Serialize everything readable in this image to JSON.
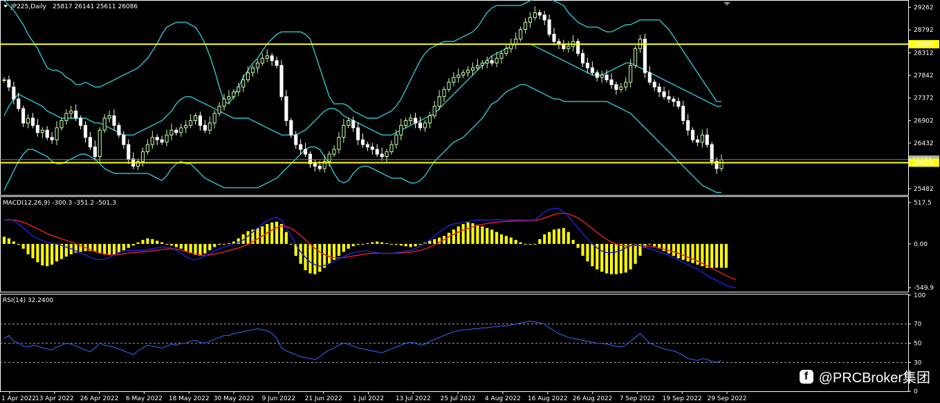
{
  "header": {
    "symbol_info": "JP225,Daily",
    "ohlc": "25817 26141 25611 26086"
  },
  "macd": {
    "label": "MACD(12,26,9) -300.3 -351.2 -501.3"
  },
  "rsi": {
    "label": "RSI(14) 32.2400"
  },
  "watermark": {
    "icon": "f",
    "text": "@PRCBroker集团"
  },
  "colors": {
    "background": "#000000",
    "bull_candle": "#ccffaa",
    "bear_candle": "#ffffff",
    "bollinger": "#2ec7d0",
    "support_resistance": "#ffff00",
    "macd_hist": "#ffff00",
    "macd_line": "#1f1fe0",
    "signal_line": "#e02020",
    "rsi_line": "#2f6fff"
  },
  "chart_data": [
    {
      "type": "candlestick",
      "name": "price",
      "x_labels": [
        "1 Apr 2022",
        "13 Apr 2022",
        "26 Apr 2022",
        "6 May 2022",
        "18 May 2022",
        "30 May 2022",
        "9 Jun 2022",
        "21 Jun 2022",
        "1 Jul 2022",
        "13 Jul 2022",
        "25 Jul 2022",
        "4 Aug 2022",
        "16 Aug 2022",
        "26 Aug 2022",
        "7 Sep 2022",
        "19 Sep 2022",
        "29 Sep 2022"
      ],
      "y_ticks": [
        29262,
        28792,
        28312,
        27842,
        27372,
        26902,
        26432,
        25482
      ],
      "ylim": [
        25350,
        29400
      ],
      "close": [
        27750,
        27600,
        27350,
        27150,
        26850,
        26950,
        26800,
        26650,
        26700,
        26550,
        26500,
        26750,
        26900,
        27050,
        27100,
        26950,
        26800,
        26550,
        26350,
        26150,
        26700,
        26950,
        27000,
        26800,
        26600,
        26400,
        26100,
        25950,
        26050,
        26250,
        26400,
        26550,
        26500,
        26450,
        26600,
        26700,
        26650,
        26750,
        26800,
        26900,
        27000,
        26800,
        26700,
        26850,
        27050,
        27200,
        27350,
        27400,
        27500,
        27600,
        27750,
        27900,
        28000,
        28100,
        28200,
        28250,
        28150,
        28050,
        27400,
        26900,
        26600,
        26400,
        26300,
        26200,
        26000,
        25950,
        25900,
        26050,
        26200,
        26300,
        26550,
        26800,
        26900,
        26750,
        26500,
        26400,
        26350,
        26300,
        26200,
        26150,
        26250,
        26400,
        26600,
        26800,
        26900,
        26950,
        26850,
        26750,
        26850,
        27000,
        27200,
        27400,
        27550,
        27700,
        27800,
        27850,
        27900,
        27950,
        28000,
        28050,
        28100,
        28150,
        28100,
        28200,
        28300,
        28400,
        28500,
        28600,
        28800,
        28950,
        29050,
        29150,
        29100,
        29000,
        28700,
        28550,
        28500,
        28400,
        28450,
        28550,
        28300,
        28100,
        28000,
        27900,
        27800,
        27850,
        27750,
        27650,
        27550,
        27600,
        27700,
        28050,
        28400,
        28600,
        27900,
        27700,
        27600,
        27500,
        27400,
        27350,
        27300,
        27200,
        26900,
        26700,
        26500,
        26450,
        26600,
        26400,
        26050,
        25900,
        26086
      ],
      "bands": [
        {
          "name": "Upper band",
          "values": [
            29400,
            29300,
            29200,
            29050,
            28900,
            28700,
            28550,
            28400,
            28200,
            28000,
            27950,
            27950,
            27900,
            27800,
            27750,
            27650,
            27650,
            27700,
            27650,
            27600,
            27600,
            27650,
            27700,
            27750,
            27800,
            27850,
            27900,
            27950,
            28000,
            28100,
            28200,
            28350,
            28500,
            28700,
            28850,
            28900,
            28950,
            28950,
            28950,
            28900,
            28850,
            28700,
            28500,
            28250,
            27950,
            27600,
            27300,
            27250,
            27400,
            27600,
            27800,
            27950,
            28100,
            28200,
            28350,
            28500,
            28600,
            28700,
            28750,
            28750,
            28750,
            28750,
            28750,
            28700,
            28600,
            28300,
            28000,
            27700,
            27400,
            27250,
            27250,
            27250,
            27200,
            27100,
            27050,
            27000,
            26950,
            26950,
            26950,
            27000,
            27050,
            27100,
            27200,
            27350,
            27550,
            27750,
            27950,
            28150,
            28300,
            28400,
            28450,
            28500,
            28550,
            28550,
            28550,
            28600,
            28650,
            28700,
            28750,
            28850,
            29000,
            29150,
            29250,
            29300,
            29300,
            29300,
            29300,
            29300,
            29300,
            29350,
            29400,
            29450,
            29450,
            29450,
            29450,
            29400,
            29350,
            29300,
            29150,
            29050,
            28950,
            28900,
            28850,
            28850,
            28850,
            28800,
            28750,
            28750,
            28800,
            28850,
            28900,
            28900,
            28950,
            29000,
            29000,
            29000,
            29000,
            29000,
            28900,
            28800,
            28650,
            28500,
            28350,
            28200,
            28050,
            27900,
            27750,
            27600,
            27450,
            27300,
            27300
          ]
        },
        {
          "name": "Middle band",
          "values": [
            27000,
            27200,
            27350,
            27450,
            27400,
            27350,
            27300,
            27250,
            27200,
            27100,
            27050,
            27000,
            26950,
            26950,
            26950,
            26950,
            26950,
            26950,
            26900,
            26850,
            26850,
            26800,
            26750,
            26700,
            26650,
            26600,
            26600,
            26600,
            26650,
            26700,
            26750,
            26800,
            26850,
            26900,
            27000,
            27100,
            27250,
            27350,
            27400,
            27400,
            27350,
            27300,
            27250,
            27200,
            27150,
            27100,
            27050,
            27000,
            26950,
            26950,
            26950,
            26950,
            26900,
            26850,
            26800,
            26750,
            26700,
            26650,
            26600,
            26600,
            26600,
            26600,
            26650,
            26700,
            26800,
            26900,
            27000,
            27100,
            27150,
            27150,
            27100,
            27000,
            26950,
            26900,
            26850,
            26800,
            26750,
            26700,
            26650,
            26600,
            26600,
            26600,
            26650,
            26700,
            26750,
            26800,
            26850,
            26900,
            26950,
            27000,
            27050,
            27150,
            27250,
            27350,
            27450,
            27550,
            27650,
            27750,
            27850,
            27950,
            28050,
            28150,
            28250,
            28300,
            28350,
            28400,
            28450,
            28500,
            28500,
            28500,
            28500,
            28450,
            28400,
            28350,
            28300,
            28250,
            28200,
            28150,
            28100,
            28050,
            28000,
            27950,
            27900,
            27850,
            27850,
            27850,
            27900,
            27950,
            28000,
            28050,
            28100,
            28100,
            28050,
            28000,
            27950,
            27900,
            27850,
            27800,
            27750,
            27700,
            27650,
            27600,
            27550,
            27500,
            27450,
            27400,
            27350,
            27300,
            27250,
            27200,
            27200
          ]
        },
        {
          "name": "Lower band",
          "values": [
            25450,
            25650,
            25850,
            26050,
            26200,
            26300,
            26300,
            26250,
            26200,
            26150,
            26050,
            26000,
            26000,
            26050,
            26100,
            26150,
            26200,
            26200,
            26150,
            26100,
            26000,
            25900,
            25850,
            25800,
            25800,
            25800,
            25800,
            25800,
            25800,
            25800,
            25800,
            25750,
            25700,
            25650,
            25750,
            25900,
            26000,
            26050,
            26000,
            26000,
            25900,
            25800,
            25700,
            25650,
            25600,
            25550,
            25500,
            25500,
            25500,
            25500,
            25500,
            25500,
            25500,
            25500,
            25550,
            25600,
            25650,
            25700,
            25800,
            25900,
            26000,
            26100,
            26200,
            26300,
            26350,
            26350,
            26300,
            26150,
            26000,
            25800,
            25650,
            25600,
            25650,
            25800,
            25900,
            25950,
            25950,
            25900,
            25850,
            25800,
            25750,
            25700,
            25700,
            25700,
            25650,
            25600,
            25600,
            25650,
            25750,
            25900,
            26050,
            26150,
            26250,
            26350,
            26450,
            26500,
            26550,
            26650,
            26750,
            26850,
            26950,
            27100,
            27250,
            27300,
            27400,
            27500,
            27550,
            27600,
            27650,
            27650,
            27600,
            27550,
            27500,
            27450,
            27400,
            27350,
            27350,
            27300,
            27300,
            27300,
            27300,
            27300,
            27300,
            27300,
            27300,
            27300,
            27300,
            27250,
            27200,
            27150,
            27100,
            27050,
            26950,
            26850,
            26750,
            26650,
            26550,
            26450,
            26350,
            26250,
            26150,
            26050,
            25950,
            25850,
            25750,
            25650,
            25550,
            25500,
            25450,
            25400,
            25400
          ]
        }
      ],
      "horizontal_lines": [
        {
          "value": 28493,
          "label": "28493"
        },
        {
          "value": 26022,
          "label": "26022"
        }
      ],
      "price_marker": {
        "value": 26086,
        "label": "26086"
      }
    },
    {
      "type": "bar",
      "name": "MACD",
      "y_ticks": [
        517.5,
        0.0,
        -549.9
      ],
      "y_tick_labels": [
        "517.5",
        "0.00",
        "-549.9"
      ],
      "ylim": [
        -600,
        580
      ],
      "histogram": [
        90,
        70,
        30,
        -10,
        -60,
        -130,
        -180,
        -230,
        -270,
        -280,
        -260,
        -220,
        -190,
        -160,
        -130,
        -110,
        -100,
        -90,
        -90,
        -100,
        -120,
        -130,
        -140,
        -130,
        -110,
        -80,
        -50,
        -20,
        20,
        50,
        70,
        60,
        40,
        20,
        0,
        -20,
        -40,
        -60,
        -90,
        -120,
        -140,
        -150,
        -120,
        -80,
        -40,
        -10,
        0,
        10,
        30,
        70,
        120,
        160,
        180,
        200,
        220,
        250,
        270,
        280,
        250,
        150,
        0,
        -150,
        -250,
        -330,
        -370,
        -380,
        -350,
        -300,
        -250,
        -200,
        -150,
        -100,
        -60,
        -30,
        -10,
        0,
        10,
        20,
        30,
        20,
        10,
        0,
        -10,
        -20,
        -30,
        -40,
        -30,
        -10,
        20,
        40,
        60,
        80,
        100,
        140,
        180,
        220,
        250,
        270,
        260,
        240,
        220,
        200,
        180,
        150,
        120,
        100,
        80,
        50,
        20,
        0,
        0,
        0,
        60,
        120,
        150,
        180,
        190,
        200,
        150,
        50,
        -50,
        -150,
        -220,
        -280,
        -320,
        -350,
        -370,
        -380,
        -380,
        -370,
        -360,
        -320,
        -250,
        -150,
        -50,
        0,
        -30,
        -60,
        -90,
        -120,
        -150,
        -180,
        -200,
        -220,
        -240,
        -260,
        -280,
        -300,
        -300,
        -300,
        -300,
        -300
      ],
      "macd": [
        300,
        310,
        290,
        250,
        200,
        150,
        100,
        70,
        40,
        20,
        10,
        0,
        -20,
        -40,
        -60,
        -90,
        -120,
        -140,
        -170,
        -190,
        -200,
        -190,
        -170,
        -140,
        -110,
        -90,
        -80,
        -80,
        -80,
        -80,
        -70,
        -60,
        -50,
        -40,
        -40,
        -50,
        -80,
        -120,
        -160,
        -190,
        -200,
        -180,
        -150,
        -120,
        -90,
        -60,
        -40,
        -20,
        0,
        20,
        50,
        100,
        150,
        200,
        250,
        290,
        320,
        330,
        300,
        200,
        100,
        0,
        -100,
        -170,
        -230,
        -260,
        -280,
        -270,
        -250,
        -220,
        -190,
        -160,
        -130,
        -110,
        -100,
        -90,
        -90,
        -100,
        -110,
        -120,
        -120,
        -120,
        -110,
        -100,
        -90,
        -80,
        -60,
        -30,
        10,
        50,
        100,
        150,
        190,
        230,
        250,
        260,
        270,
        280,
        290,
        300,
        300,
        300,
        300,
        300,
        300,
        300,
        300,
        300,
        300,
        300,
        300,
        300,
        350,
        400,
        430,
        450,
        440,
        400,
        340,
        270,
        200,
        130,
        60,
        0,
        -50,
        -90,
        -110,
        -110,
        -100,
        -80,
        -50,
        -20,
        -10,
        -20,
        -40,
        -60,
        -80,
        -100,
        -120,
        -140,
        -170,
        -200,
        -230,
        -260,
        -290,
        -320,
        -350,
        -400,
        -430,
        -460,
        -490,
        -520,
        -540,
        -550
      ]
    },
    {
      "type": "line",
      "name": "RSI",
      "y_ticks": [
        100,
        70,
        50,
        30,
        0
      ],
      "y_tick_labels": [
        "100",
        "70",
        "50",
        "30",
        "0"
      ],
      "levels": [
        70,
        50,
        30
      ],
      "ylim": [
        0,
        100
      ],
      "values": [
        55,
        58,
        52,
        50,
        47,
        46,
        48,
        47,
        45,
        44,
        43,
        46,
        48,
        50,
        49,
        47,
        45,
        43,
        41,
        45,
        50,
        48,
        47,
        46,
        44,
        42,
        40,
        38,
        42,
        45,
        48,
        47,
        46,
        45,
        47,
        49,
        48,
        50,
        50,
        52,
        53,
        51,
        50,
        52,
        54,
        56,
        58,
        58,
        60,
        61,
        62,
        63,
        64,
        65,
        64,
        63,
        60,
        55,
        45,
        42,
        40,
        38,
        36,
        35,
        34,
        33,
        36,
        40,
        43,
        45,
        48,
        50,
        49,
        47,
        45,
        44,
        43,
        42,
        41,
        40,
        42,
        44,
        46,
        48,
        50,
        51,
        50,
        48,
        49,
        52,
        54,
        56,
        58,
        60,
        62,
        63,
        64,
        64,
        65,
        65,
        66,
        66,
        67,
        67,
        68,
        68,
        69,
        70,
        71,
        72,
        73,
        72,
        71,
        70,
        66,
        63,
        60,
        58,
        56,
        55,
        54,
        53,
        52,
        51,
        50,
        50,
        49,
        48,
        47,
        46,
        48,
        52,
        56,
        60,
        55,
        50,
        48,
        46,
        44,
        43,
        42,
        40,
        37,
        34,
        33,
        32,
        34,
        33,
        31,
        30,
        32
      ]
    }
  ]
}
